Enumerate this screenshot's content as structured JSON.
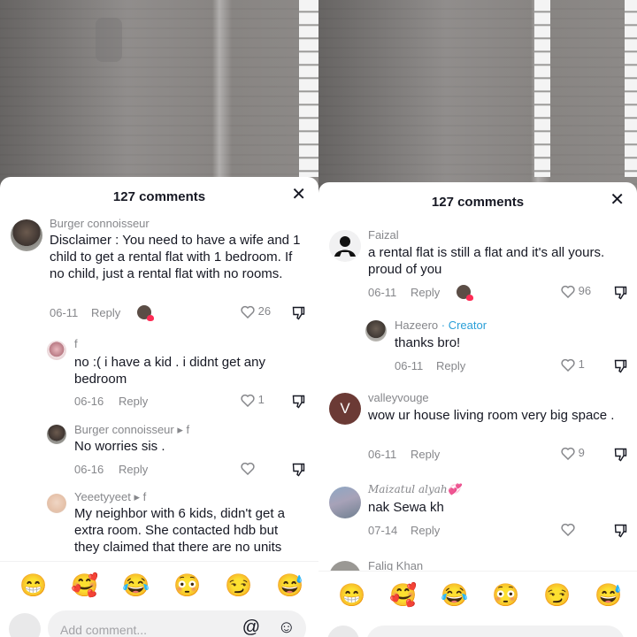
{
  "left": {
    "header": {
      "title": "127 comments",
      "close": "✕"
    },
    "comments": [
      {
        "username": "Burger connoisseur",
        "text": "Disclaimer : You need to have a wife and 1 child to get a rental flat with 1 bedroom. If no child, just a rental flat with no rooms.",
        "date": "06-11",
        "reply": "Reply",
        "likes": "26"
      },
      {
        "username": "f",
        "text": "no :( i have a kid . i didnt get any bedroom",
        "date": "06-16",
        "reply": "Reply",
        "likes": "1"
      },
      {
        "username": "Burger connoisseur ▸ f",
        "text": "No worries sis .",
        "date": "06-16",
        "reply": "Reply",
        "likes": ""
      },
      {
        "username": "Yeeetyyeet ▸ f",
        "text": "My neighbor with 6 kids, didn't get a extra room. She contacted hdb but they claimed that there are no units",
        "date": "",
        "reply": "",
        "likes": ""
      }
    ],
    "emojis": [
      "😁",
      "🥰",
      "😂",
      "😳",
      "😏",
      "😅"
    ],
    "input": {
      "placeholder": "Add comment...",
      "at": "@",
      "emoji": "☺"
    }
  },
  "right": {
    "header": {
      "title": "127 comments",
      "close": "✕"
    },
    "comments": [
      {
        "username": "Faizal",
        "text": "a rental flat is still a flat and it's all yours. proud of you",
        "date": "06-11",
        "reply": "Reply",
        "likes": "96"
      },
      {
        "username": "Hazeero",
        "badge": "· Creator",
        "text": "thanks bro!",
        "date": "06-11",
        "reply": "Reply",
        "likes": "1"
      },
      {
        "username": "valleyvouge",
        "avatar_letter": "V",
        "text": "wow ur house living room very big space .",
        "date": "06-11",
        "reply": "Reply",
        "likes": "9"
      },
      {
        "username": "Maizatul alyah💞",
        "text": "nak Sewa kh",
        "date": "07-14",
        "reply": "Reply",
        "likes": ""
      },
      {
        "username": "Faliq Khan",
        "text": "",
        "date": "",
        "reply": "",
        "likes": ""
      }
    ],
    "emojis": [
      "😁",
      "🥰",
      "😂",
      "😳",
      "😏",
      "😅"
    ]
  },
  "colors": {
    "accent": "#fe2c55",
    "creator": "#2a9fd8",
    "muted": "#86878b",
    "text": "#161823"
  },
  "icons": {
    "like": "heart-outline-icon",
    "dislike": "thumbs-down-icon"
  }
}
